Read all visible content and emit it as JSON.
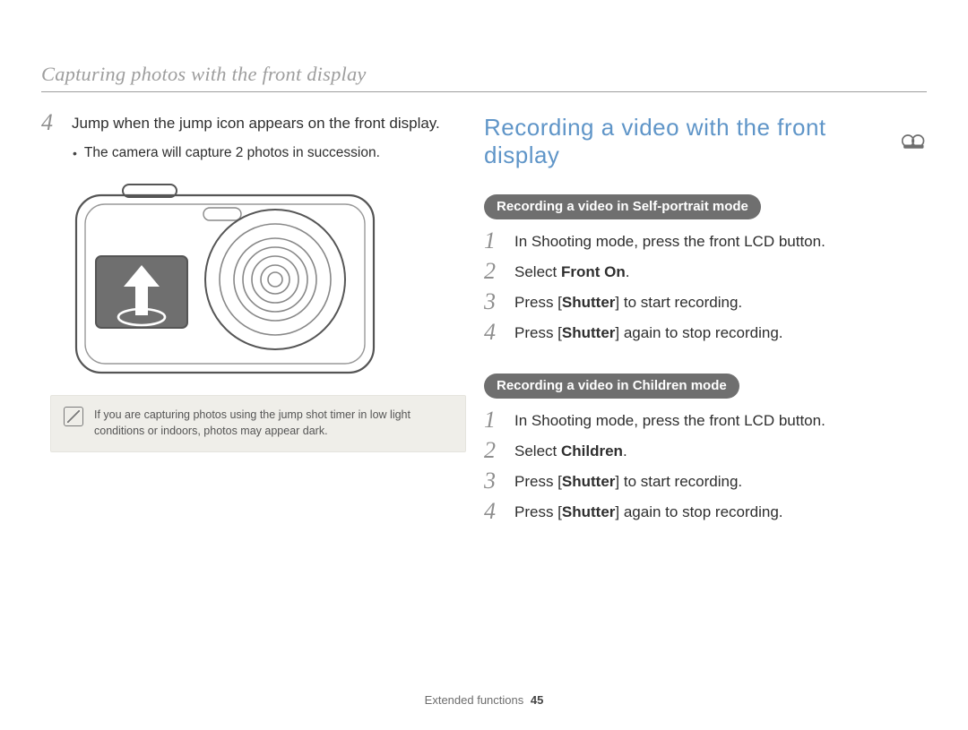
{
  "running_head": "Capturing photos with the front display",
  "left": {
    "step4_num": "4",
    "step4_text": "Jump when the jump icon appears on the front display.",
    "sub_bullet": "The camera will capture 2 photos in succession.",
    "note": "If you are capturing photos using the jump shot timer in low light conditions or indoors, photos may appear dark."
  },
  "right": {
    "title": "Recording a video with the front display",
    "blockA": {
      "pill": "Recording a video in Self-portrait mode",
      "s1_num": "1",
      "s1_text": "In Shooting mode, press the front LCD button.",
      "s2_num": "2",
      "s2_pre": "Select ",
      "s2_bold": "Front On",
      "s2_post": ".",
      "s3_num": "3",
      "s3_pre": "Press [",
      "s3_bold": "Shutter",
      "s3_post": "] to start recording.",
      "s4_num": "4",
      "s4_pre": "Press [",
      "s4_bold": "Shutter",
      "s4_post": "] again to stop recording."
    },
    "blockB": {
      "pill": "Recording a video in Children mode",
      "s1_num": "1",
      "s1_text": "In Shooting mode, press the front LCD button.",
      "s2_num": "2",
      "s2_pre": "Select ",
      "s2_bold": "Children",
      "s2_post": ".",
      "s3_num": "3",
      "s3_pre": "Press [",
      "s3_bold": "Shutter",
      "s3_post": "] to start recording.",
      "s4_num": "4",
      "s4_pre": "Press [",
      "s4_bold": "Shutter",
      "s4_post": "] again to stop recording."
    }
  },
  "footer": {
    "label": "Extended functions",
    "page": "45"
  }
}
